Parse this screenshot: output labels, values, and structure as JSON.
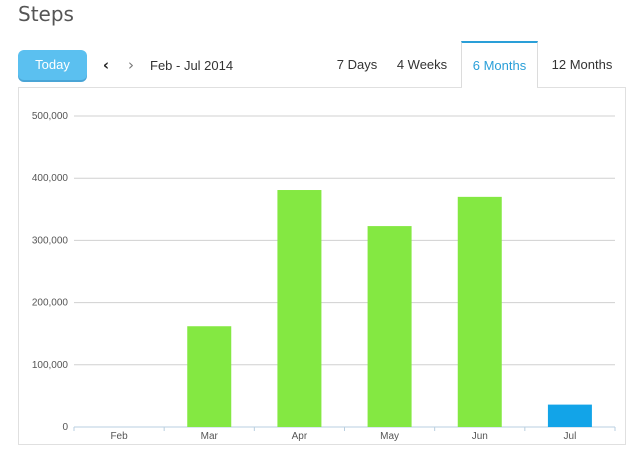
{
  "header": {
    "title": "Steps"
  },
  "toolbar": {
    "today_label": "Today",
    "prev_icon": "chevron-left-icon",
    "next_icon": "chevron-right-icon",
    "prev_glyph": "‹",
    "next_glyph": "›",
    "date_range": "Feb - Jul 2014"
  },
  "tabs": [
    {
      "label": "7 Days",
      "active": false
    },
    {
      "label": "4 Weeks",
      "active": false
    },
    {
      "label": "6 Months",
      "active": true
    },
    {
      "label": "12 Months",
      "active": false
    }
  ],
  "colors": {
    "accent": "#2a9fd8",
    "bar": "#84e842",
    "bar_current": "#12a4e8",
    "today_button": "#5bc0f0"
  },
  "chart_data": {
    "type": "bar",
    "categories": [
      "Feb",
      "Mar",
      "Apr",
      "May",
      "Jun",
      "Jul"
    ],
    "values": [
      0,
      162000,
      381000,
      323000,
      370000,
      36000
    ],
    "highlight_index": 5,
    "ylim": [
      0,
      500000
    ],
    "yticks": [
      "0",
      "100,000",
      "200,000",
      "300,000",
      "400,000",
      "500,000"
    ],
    "ytick_values": [
      0,
      100000,
      200000,
      300000,
      400000,
      500000
    ],
    "grid": true
  }
}
